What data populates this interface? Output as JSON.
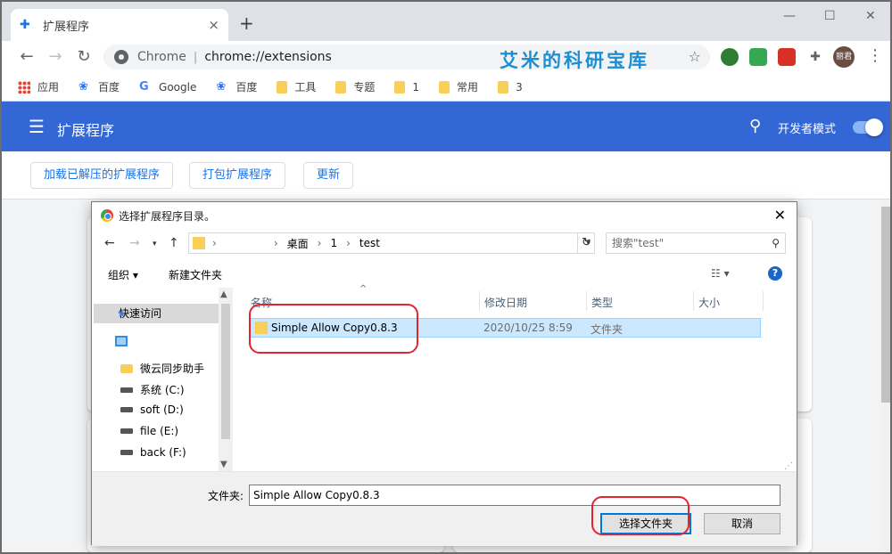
{
  "tab": {
    "title": "扩展程序",
    "close": "×",
    "new_tab": "+"
  },
  "window_controls": {
    "minimize": "—",
    "maximize": "☐",
    "close": "✕"
  },
  "toolbar": {
    "back": "←",
    "forward": "→",
    "reload": "↻",
    "site_label": "Chrome",
    "url": "chrome://extensions",
    "watermark": "艾米的科研宝库",
    "avatar_text": "丽君",
    "menu": "⋮",
    "star": "☆"
  },
  "extensions_icons": [
    {
      "name": "globe-extension-icon",
      "color": "#2e7d32"
    },
    {
      "name": "shield-extension-icon",
      "color": "#34a853"
    },
    {
      "name": "red-extension-icon",
      "color": "#d93025"
    },
    {
      "name": "puzzle-extension-icon",
      "color": "#5f6368"
    }
  ],
  "bookmarks": [
    {
      "label": "应用",
      "icon": "apps"
    },
    {
      "label": "百度",
      "icon": "paw"
    },
    {
      "label": "Google",
      "icon": "g"
    },
    {
      "label": "百度",
      "icon": "paw"
    },
    {
      "label": "工具",
      "icon": "folder"
    },
    {
      "label": "专题",
      "icon": "folder"
    },
    {
      "label": "1",
      "icon": "folder"
    },
    {
      "label": "常用",
      "icon": "folder"
    },
    {
      "label": "3",
      "icon": "folder"
    }
  ],
  "ext_page": {
    "title": "扩展程序",
    "dev_mode_label": "开发者模式",
    "dev_mode_on": true,
    "buttons": {
      "load_unpacked": "加载已解压的扩展程序",
      "pack": "打包扩展程序",
      "update": "更新"
    },
    "header_color": "#3367d6"
  },
  "dialog": {
    "title": "选择扩展程序目录。",
    "breadcrumbs": [
      "›",
      "桌面",
      "›",
      "1",
      "›",
      "test"
    ],
    "search_placeholder": "搜索\"test\"",
    "commands": {
      "organize": "组织 ▾",
      "new_folder": "新建文件夹",
      "help": "?"
    },
    "nav": {
      "quick_access": "快速访问",
      "items": [
        "微云同步助手",
        "系统 (C:)",
        "soft (D:)",
        "file (E:)",
        "back (F:)"
      ]
    },
    "columns": {
      "name": "名称",
      "modified": "修改日期",
      "type": "类型",
      "size": "大小"
    },
    "files": [
      {
        "name": "Simple Allow Copy0.8.3",
        "modified": "2020/10/25 8:59",
        "type": "文件夹",
        "size": ""
      }
    ],
    "folder_label": "文件夹:",
    "folder_value": "Simple Allow Copy0.8.3",
    "select_button": "选择文件夹",
    "cancel_button": "取消"
  }
}
